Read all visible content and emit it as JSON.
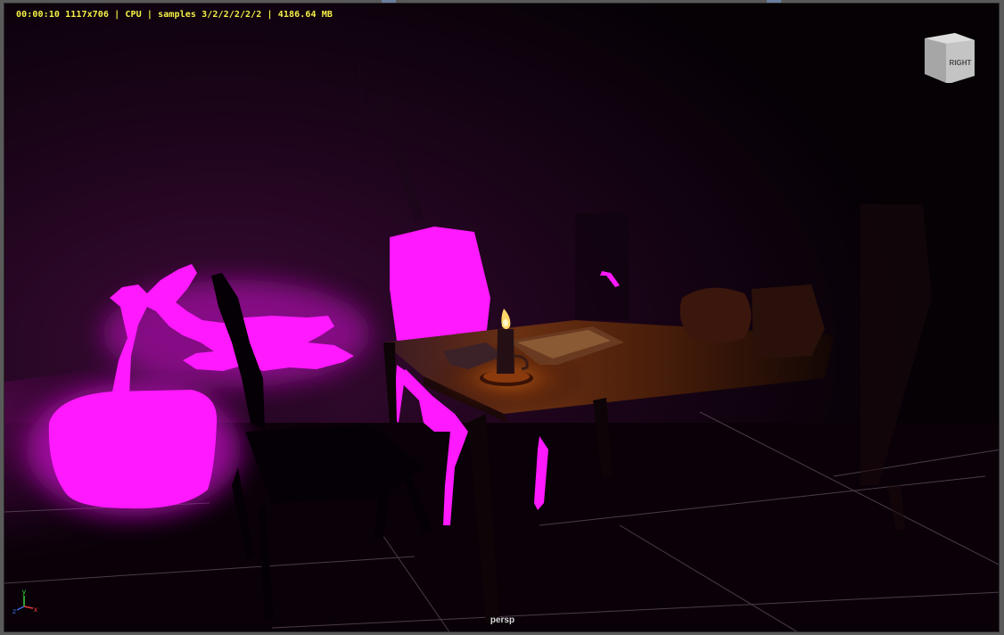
{
  "viewport": {
    "hud_text": "00:00:10 1117x706 | CPU | samples 3/2/2/2/2/2 | 4186.64 MB",
    "camera_label": "persp",
    "view_cube_label": "RIGHT",
    "axis_labels": {
      "x": "x",
      "y": "y",
      "z": "z"
    }
  },
  "colors": {
    "glow_magenta": "#ff19ff",
    "candle_flame": "#ffd76a",
    "table_lit": "#5a2a10",
    "hud_text": "#f5f046"
  },
  "icons": {
    "view_cube": "view-cube-icon",
    "axis_gizmo": "axis-gizmo-icon"
  }
}
